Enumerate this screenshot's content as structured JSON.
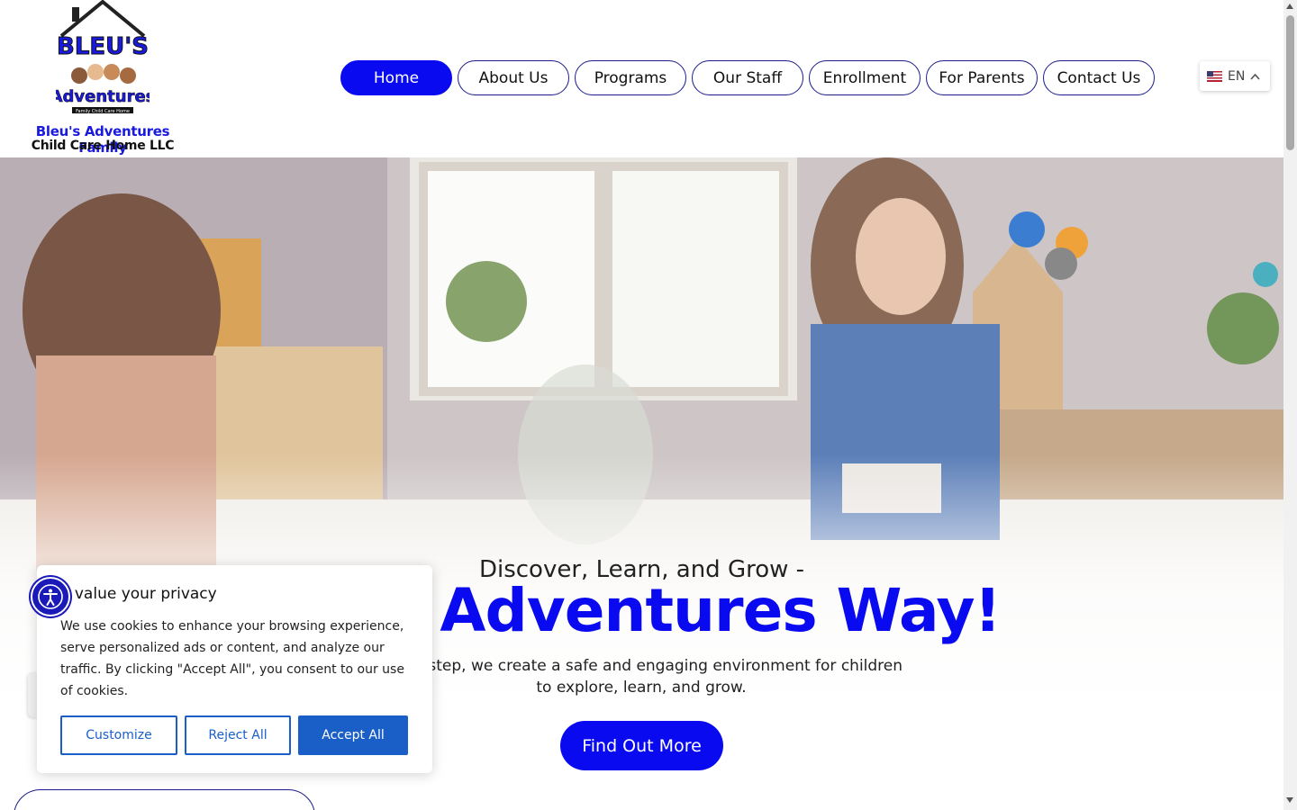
{
  "logo": {
    "art_text": "BLEU'S",
    "art_text2": "Adventures",
    "art_tagline": "Family Child Care Home",
    "line1": "Bleu's Adventures Family",
    "line2": "Child Care Home LLC"
  },
  "nav": {
    "items": [
      {
        "label": "Home",
        "active": true
      },
      {
        "label": "About Us"
      },
      {
        "label": "Programs"
      },
      {
        "label": "Our Staff"
      },
      {
        "label": "Enrollment"
      },
      {
        "label": "For Parents"
      },
      {
        "label": "Contact Us"
      }
    ]
  },
  "language": {
    "code": "EN",
    "flag_icon": "us-flag-icon"
  },
  "hero": {
    "subtitle": "Discover, Learn, and Grow -",
    "title": "eu’s Adventures Way!",
    "description": "every step, we create a safe and engaging environment for children to explore, learn, and grow.",
    "cta_label": "Find Out More"
  },
  "cookie": {
    "title": "e value your privacy",
    "text": "We use cookies to enhance your browsing experience, serve personalized ads or content, and analyze our traffic. By clicking \"Accept All\", you consent to our use of cookies.",
    "customize_label": "Customize",
    "reject_label": "Reject All",
    "accept_label": "Accept All"
  },
  "colors": {
    "brand_blue": "#0a0af0",
    "cookie_blue": "#1a5fc8",
    "nav_border": "#1b1b8a"
  }
}
